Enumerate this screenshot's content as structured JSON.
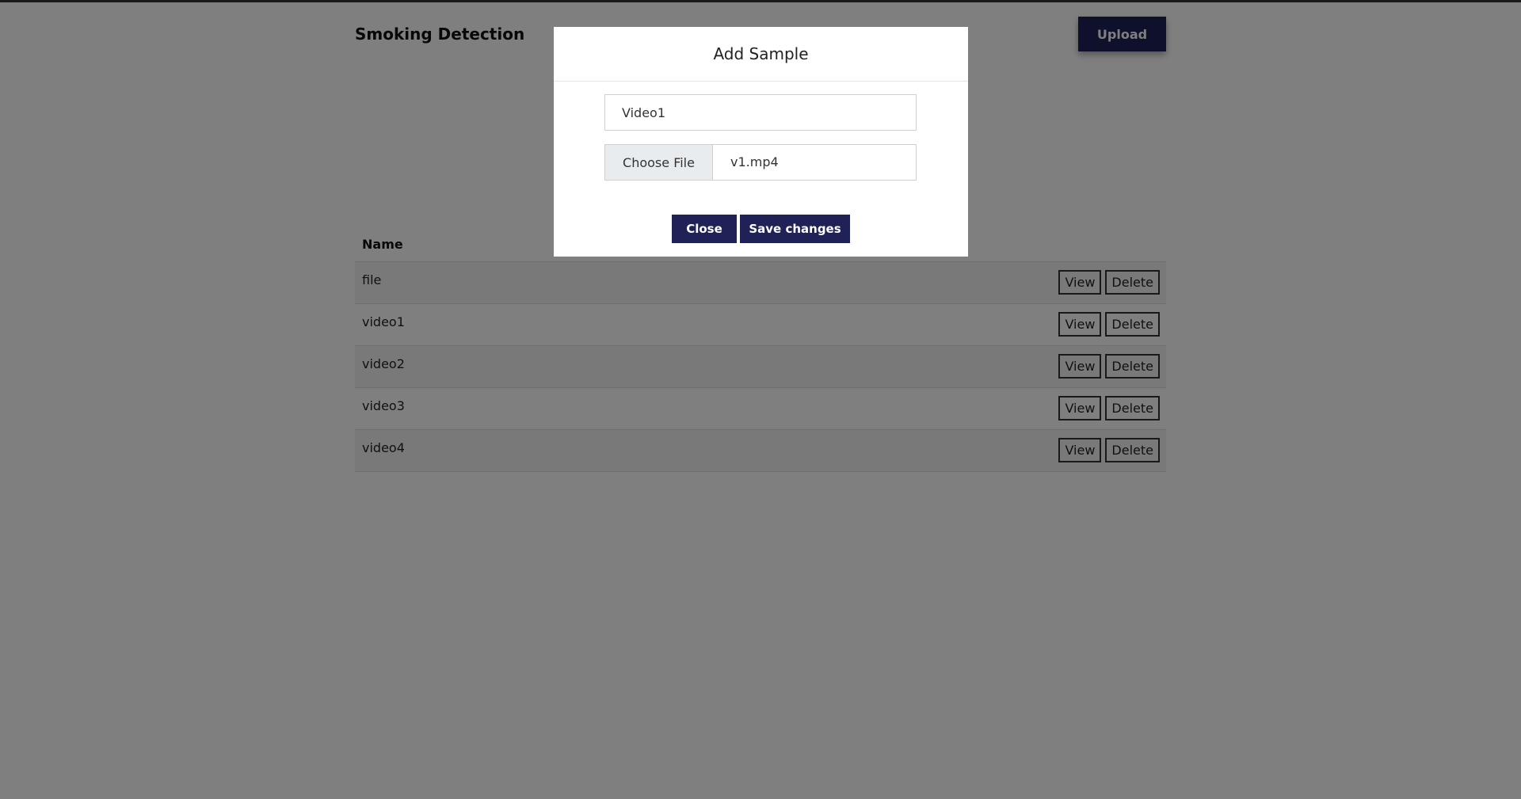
{
  "header": {
    "title": "Smoking Detection",
    "upload_label": "Upload"
  },
  "table": {
    "columns": [
      "Name"
    ],
    "rows": [
      {
        "name": "file",
        "view_label": "View",
        "delete_label": "Delete"
      },
      {
        "name": "video1",
        "view_label": "View",
        "delete_label": "Delete"
      },
      {
        "name": "video2",
        "view_label": "View",
        "delete_label": "Delete"
      },
      {
        "name": "video3",
        "view_label": "View",
        "delete_label": "Delete"
      },
      {
        "name": "video4",
        "view_label": "View",
        "delete_label": "Delete"
      }
    ]
  },
  "modal": {
    "title": "Add Sample",
    "name_value": "Video1",
    "choose_file_label": "Choose File",
    "file_name": "v1.mp4",
    "close_label": "Close",
    "save_label": "Save changes"
  },
  "colors": {
    "primary_button": "#1f2157",
    "overlay": "rgba(0,0,0,0.5)",
    "row_stripe": "#f2f2f2"
  }
}
